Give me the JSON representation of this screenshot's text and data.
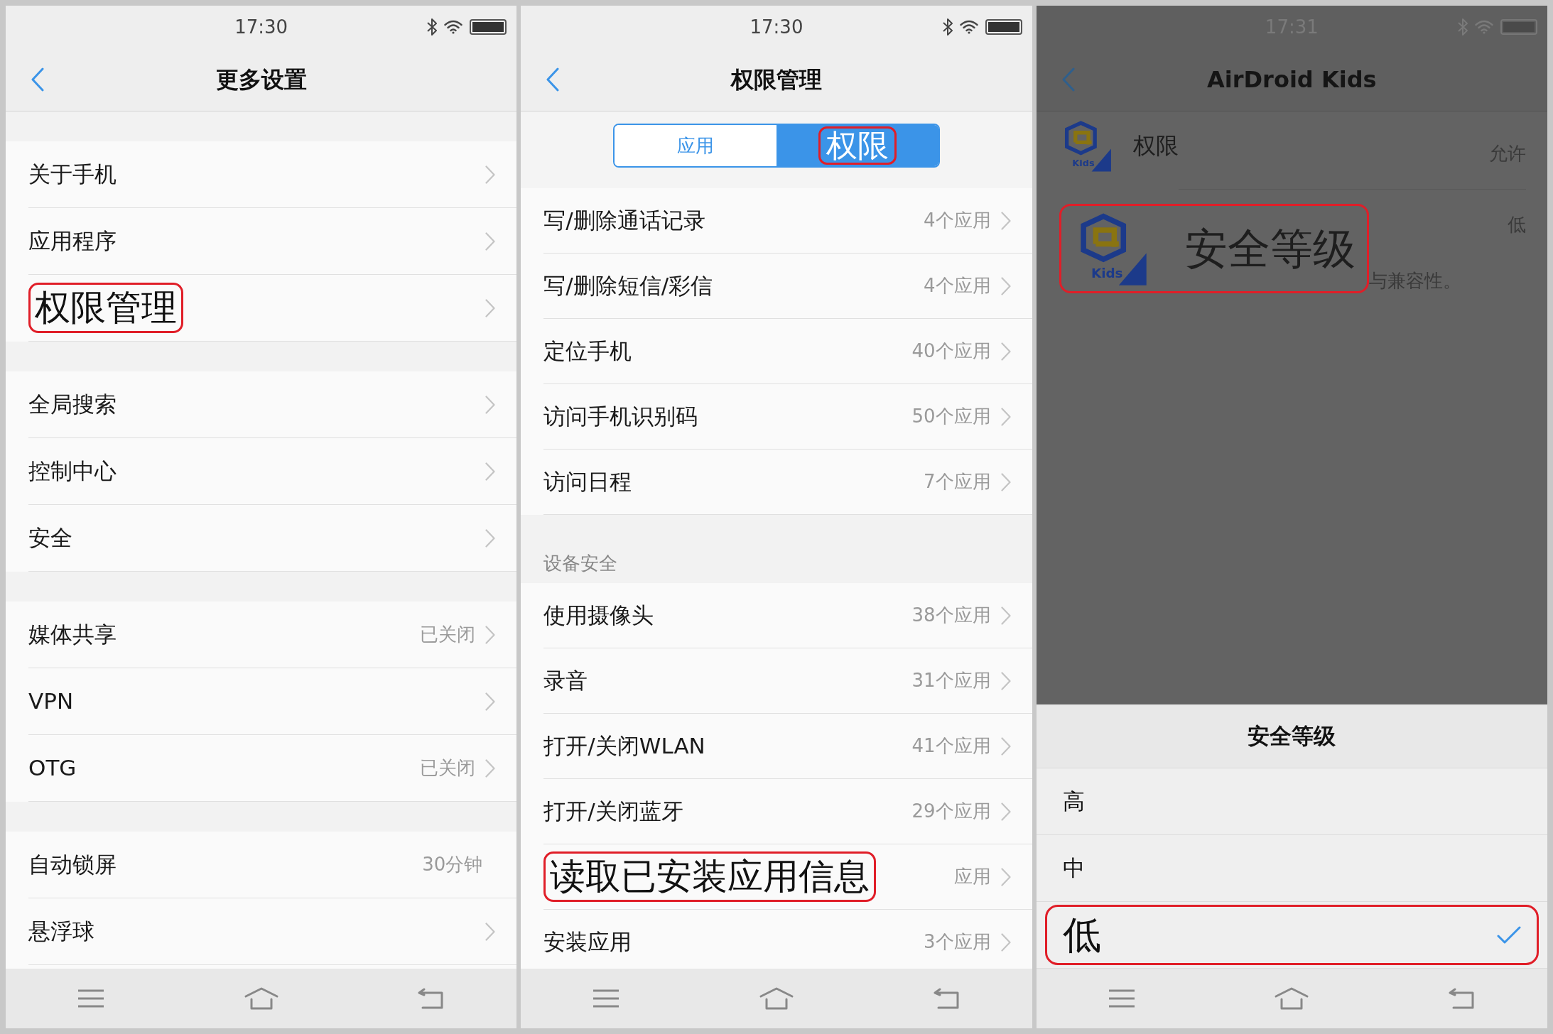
{
  "panels": [
    {
      "kind": "list",
      "dimmed": false,
      "status_bar": {
        "time": "17:30"
      },
      "nav": {
        "title": "更多设置"
      },
      "groups": [
        {
          "items": [
            {
              "label": "关于手机",
              "chevron": true,
              "highlighted": false
            },
            {
              "label": "应用程序",
              "chevron": true,
              "highlighted": false
            },
            {
              "label": "权限管理",
              "chevron": true,
              "highlighted": true
            }
          ]
        },
        {
          "items": [
            {
              "label": "全局搜索",
              "chevron": true,
              "highlighted": false
            },
            {
              "label": "控制中心",
              "chevron": true,
              "highlighted": false
            },
            {
              "label": "安全",
              "chevron": true,
              "highlighted": false
            }
          ]
        },
        {
          "items": [
            {
              "label": "媒体共享",
              "value": "已关闭",
              "chevron": true,
              "highlighted": false
            },
            {
              "label": "VPN",
              "chevron": true,
              "highlighted": false
            },
            {
              "label": "OTG",
              "value": "已关闭",
              "chevron": true,
              "highlighted": false
            }
          ]
        },
        {
          "items": [
            {
              "label": "自动锁屏",
              "value": "30分钟",
              "chevron": false,
              "highlighted": false
            },
            {
              "label": "悬浮球",
              "chevron": true,
              "highlighted": false
            }
          ]
        }
      ]
    },
    {
      "kind": "list",
      "dimmed": false,
      "status_bar": {
        "time": "17:30"
      },
      "nav": {
        "title": "权限管理"
      },
      "segments": [
        {
          "label": "应用",
          "selected": false,
          "highlighted": false
        },
        {
          "label": "权限",
          "selected": true,
          "highlighted": true
        }
      ],
      "groups": [
        {
          "items": [
            {
              "label": "写/删除通话记录",
              "value": "4个应用",
              "chevron": true,
              "highlighted": false
            },
            {
              "label": "写/删除短信/彩信",
              "value": "4个应用",
              "chevron": true,
              "highlighted": false
            },
            {
              "label": "定位手机",
              "value": "40个应用",
              "chevron": true,
              "highlighted": false
            },
            {
              "label": "访问手机识别码",
              "value": "50个应用",
              "chevron": true,
              "highlighted": false
            },
            {
              "label": "访问日程",
              "value": "7个应用",
              "chevron": true,
              "highlighted": false
            }
          ]
        },
        {
          "header": "设备安全",
          "items": [
            {
              "label": "使用摄像头",
              "value": "38个应用",
              "chevron": true,
              "highlighted": false
            },
            {
              "label": "录音",
              "value": "31个应用",
              "chevron": true,
              "highlighted": false
            },
            {
              "label": "打开/关闭WLAN",
              "value": "41个应用",
              "chevron": true,
              "highlighted": false
            },
            {
              "label": "打开/关闭蓝牙",
              "value": "29个应用",
              "chevron": true,
              "highlighted": false
            },
            {
              "label": "读取已安装应用信息",
              "value": "应用",
              "chevron": true,
              "highlighted": true
            },
            {
              "label": "安装应用",
              "value": "3个应用",
              "chevron": true,
              "highlighted": false
            }
          ]
        }
      ]
    },
    {
      "kind": "app",
      "dimmed": true,
      "status_bar": {
        "time": "17:31"
      },
      "nav": {
        "title": "AirDroid Kids"
      },
      "app_rows": [
        {
          "label": "权限",
          "value": "允许",
          "logo_text": "Kids",
          "highlighted": false
        },
        {
          "label": "安全等级",
          "value": "低",
          "description": "与兼容性。",
          "logo_text": "Kids",
          "highlighted": true
        }
      ],
      "sheet": {
        "title": "安全等级",
        "options": [
          {
            "label": "高",
            "selected": false,
            "highlighted": false
          },
          {
            "label": "中",
            "selected": false,
            "highlighted": false
          },
          {
            "label": "低",
            "selected": true,
            "highlighted": true
          }
        ]
      }
    }
  ]
}
